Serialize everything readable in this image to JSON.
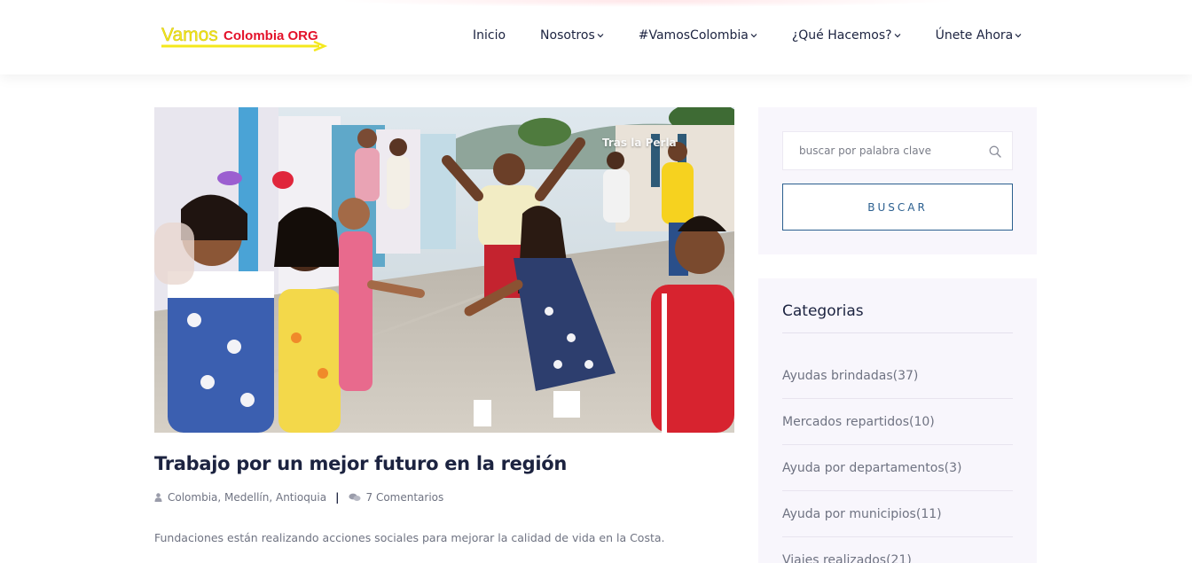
{
  "header": {
    "logo": {
      "word1": "Vamos",
      "word2": "Colombia ORG"
    },
    "nav": [
      {
        "label": "Inicio",
        "has_dropdown": false
      },
      {
        "label": "Nosotros",
        "has_dropdown": true
      },
      {
        "label": "#VamosColombia",
        "has_dropdown": true
      },
      {
        "label": "¿Qué Hacemos?",
        "has_dropdown": true
      },
      {
        "label": "Únete Ahora",
        "has_dropdown": true
      }
    ]
  },
  "post": {
    "image_watermark": "Tras la Perla",
    "title": "Trabajo por un mejor futuro en la región",
    "author_icon": "user-icon",
    "location": "Colombia, Medellín, Antioquia",
    "separator": "|",
    "comments_icon": "comments-icon",
    "comments": "7 Comentarios",
    "excerpt": "Fundaciones están realizando acciones sociales para mejorar la calidad de vida en la Costa."
  },
  "sidebar": {
    "search": {
      "placeholder": "buscar por palabra clave",
      "value": "",
      "icon": "search-icon",
      "button_label": "BUSCAR"
    },
    "categories": {
      "title": "Categorias",
      "items": [
        {
          "label": "Ayudas brindadas(37)"
        },
        {
          "label": "Mercados repartidos(10)"
        },
        {
          "label": "Ayuda por departamentos(3)"
        },
        {
          "label": "Ayuda por municipios(11)"
        },
        {
          "label": "Viajes realizados(21)"
        }
      ]
    }
  },
  "colors": {
    "heading": "#1c2340",
    "body_text": "#6f7382",
    "accent": "#2b5f8f",
    "sidebar_bg": "#f8f6fc",
    "logo_yellow": "#f4e81c",
    "logo_red": "#e3122a"
  }
}
